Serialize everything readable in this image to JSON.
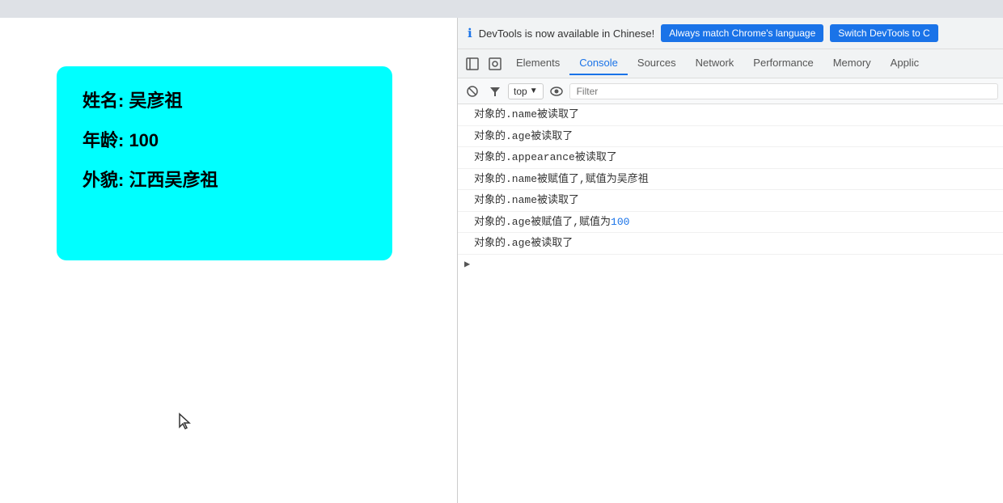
{
  "topbar": {},
  "page": {
    "card": {
      "name_label": "姓名: 吴彦祖",
      "age_label": "年龄: 100",
      "appearance_label": "外貌: 江西吴彦祖"
    }
  },
  "devtools": {
    "banner": {
      "text": "DevTools is now available in Chinese!",
      "btn_match": "Always match Chrome's language",
      "btn_switch": "Switch DevTools to C"
    },
    "tabs": {
      "items": [
        {
          "label": "Elements",
          "active": false
        },
        {
          "label": "Console",
          "active": true
        },
        {
          "label": "Sources",
          "active": false
        },
        {
          "label": "Network",
          "active": false
        },
        {
          "label": "Performance",
          "active": false
        },
        {
          "label": "Memory",
          "active": false
        },
        {
          "label": "Applic",
          "active": false
        }
      ]
    },
    "toolbar": {
      "context": "top",
      "filter_placeholder": "Filter"
    },
    "console_lines": [
      {
        "text": "对象的.name被读取了",
        "highlight": false
      },
      {
        "text": "对象的.age被读取了",
        "highlight": false
      },
      {
        "text": "对象的.appearance被读取了",
        "highlight": false
      },
      {
        "text": "对象的.name被赋值了,赋值为吴彦祖",
        "highlight": false
      },
      {
        "text": "对象的.name被读取了",
        "highlight": false
      },
      {
        "text": "对象的.age被赋值了,赋值为100",
        "highlight": true
      },
      {
        "text": "对象的.age被读取了",
        "highlight": false
      }
    ]
  }
}
